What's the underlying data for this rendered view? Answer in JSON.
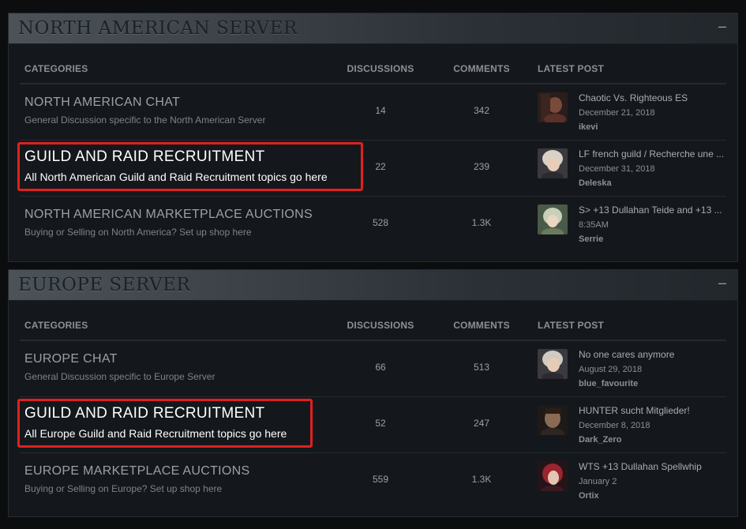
{
  "sections": [
    {
      "title": "NORTH AMERICAN SERVER",
      "collapse_label": "–",
      "headers": {
        "categories": "CATEGORIES",
        "discussions": "DISCUSSIONS",
        "comments": "COMMENTS",
        "latest_post": "LATEST POST"
      },
      "rows": [
        {
          "name": "NORTH AMERICAN CHAT",
          "desc": "General Discussion specific to the North American Server",
          "discussions": "14",
          "comments": "342",
          "post_title": "Chaotic Vs. Righteous ES",
          "post_date": "December 21, 2018",
          "post_user": "ikevi"
        },
        {
          "name": "GUILD AND RAID RECRUITMENT",
          "desc": "All North American Guild and Raid Recruitment topics go here",
          "discussions": "22",
          "comments": "239",
          "post_title": "LF french guild / Recherche une ...",
          "post_date": "December 31, 2018",
          "post_user": "Deleska"
        },
        {
          "name": "NORTH AMERICAN MARKETPLACE AUCTIONS",
          "desc": "Buying or Selling on North America? Set up shop here",
          "discussions": "528",
          "comments": "1.3K",
          "post_title": "S> +13 Dullahan Teide and +13 ...",
          "post_date": "8:35AM",
          "post_user": "Serrie"
        }
      ]
    },
    {
      "title": "EUROPE SERVER",
      "collapse_label": "–",
      "headers": {
        "categories": "CATEGORIES",
        "discussions": "DISCUSSIONS",
        "comments": "COMMENTS",
        "latest_post": "LATEST POST"
      },
      "rows": [
        {
          "name": "EUROPE CHAT",
          "desc": "General Discussion specific to Europe Server",
          "discussions": "66",
          "comments": "513",
          "post_title": "No one cares anymore",
          "post_date": "August 29, 2018",
          "post_user": "blue_favourite"
        },
        {
          "name": "GUILD AND RAID RECRUITMENT",
          "desc": "All Europe Guild and Raid Recruitment topics go here",
          "discussions": "52",
          "comments": "247",
          "post_title": "HUNTER sucht Mitglieder!",
          "post_date": "December 8, 2018",
          "post_user": "Dark_Zero"
        },
        {
          "name": "EUROPE MARKETPLACE AUCTIONS",
          "desc": "Buying or Selling on Europe? Set up shop here",
          "discussions": "559",
          "comments": "1.3K",
          "post_title": "WTS +13 Dullahan Spellwhip",
          "post_date": "January 2",
          "post_user": "Ortix"
        }
      ]
    }
  ],
  "colors": {
    "highlight_box": "#e02020",
    "panel_bg": "#14181c",
    "page_bg": "#0b0d0f"
  }
}
